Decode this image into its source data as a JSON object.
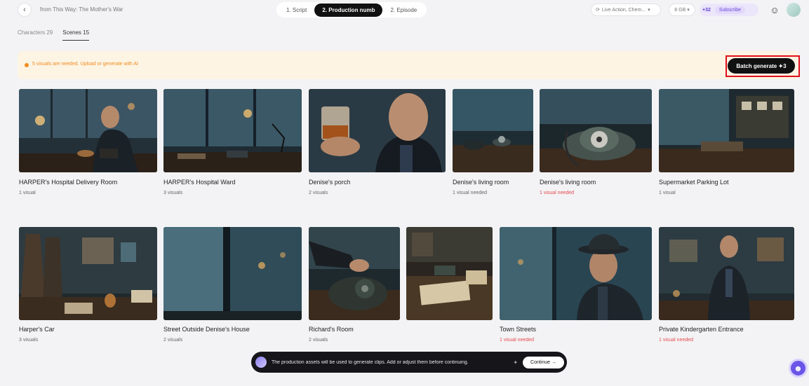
{
  "header": {
    "back_icon": "chevron-left-icon",
    "project_title": "from This Way: The Mother's War",
    "steps": [
      {
        "label": "1. Script",
        "active": false
      },
      {
        "label": "2. Production numb",
        "active": true
      },
      {
        "label": "2. Episode",
        "active": false
      }
    ],
    "mode_select": "Live Action, Chem...",
    "storage": "8 GB",
    "credits": "+32",
    "subscribe_label": "Subscribe"
  },
  "tabs": [
    {
      "label": "Characters 29",
      "active": false
    },
    {
      "label": "Scenes 15",
      "active": true
    }
  ],
  "notice": {
    "text": "5 visuals are needed. Upload or generate with AI",
    "button_label": "Batch generate ✦3"
  },
  "scenes": [
    {
      "title": "HARPER's Hospital Delivery Room",
      "subtitle": "1 visual",
      "warn": false
    },
    {
      "title": "HARPER's Hospital Ward",
      "subtitle": "3 visuals",
      "warn": false
    },
    {
      "title": "Denise's porch",
      "subtitle": "2 visuals",
      "warn": false
    },
    {
      "title": "Denise's living room",
      "subtitle": "1 visual needed",
      "warn": false
    },
    {
      "title": "Denise's living room",
      "subtitle": "1 visual needed",
      "warn": true
    },
    {
      "title": "Supermarket Parking Lot",
      "subtitle": "1 visual",
      "warn": false
    },
    {
      "title": "Harper's Car",
      "subtitle": "3 visuals",
      "warn": false
    },
    {
      "title": "Street Outside Denise's House",
      "subtitle": "2 visuals",
      "warn": false
    },
    {
      "title": "Richard's Room",
      "subtitle": "2 visuals",
      "warn": false
    },
    {
      "title": "",
      "subtitle": "",
      "warn": false
    },
    {
      "title": "Town Streets",
      "subtitle": "1 visual needed",
      "warn": true
    },
    {
      "title": "Private Kindergarten Entrance",
      "subtitle": "1 visual needed",
      "warn": true
    }
  ],
  "bottom_bar": {
    "text": "The production assets will be used to generate clips. Add or adjust them before continuing.",
    "continue_label": "Continue →"
  },
  "colors": {
    "accent": "#6a48d8",
    "warning": "#f28b20",
    "error": "#e5484d",
    "highlight_box": "#e0101a"
  }
}
